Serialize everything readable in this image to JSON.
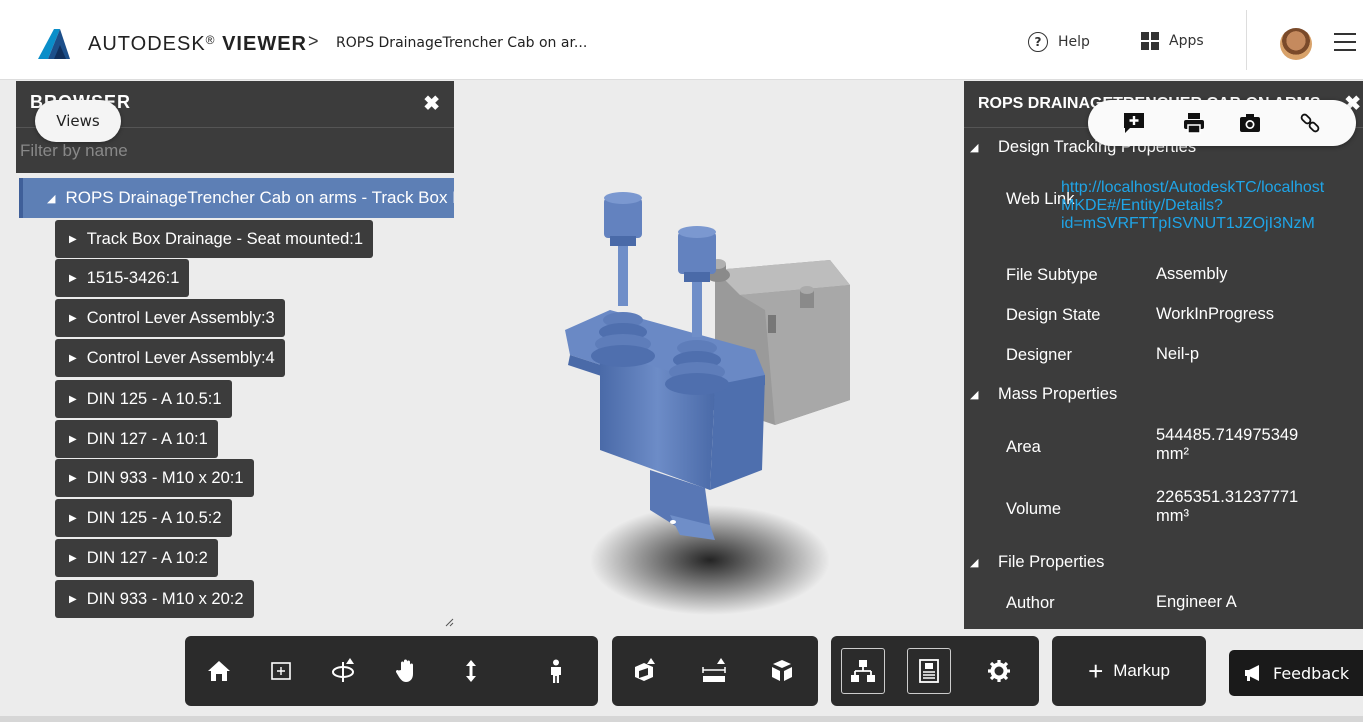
{
  "header": {
    "brand_light": "AUTODESK",
    "brand_reg": "®",
    "brand_bold": "VIEWER",
    "breadcrumb_sep": ">",
    "breadcrumb": "ROPS DrainageTrencher Cab on ar...",
    "help_icon": "?",
    "help_label": "Help",
    "apps_label": "Apps"
  },
  "browser": {
    "title": "BROWSER",
    "close": "✖",
    "views_label": "Views",
    "filter_placeholder": "Filter by name",
    "root": "ROPS DrainageTrencher Cab on arms - Track Box Drainage",
    "items": [
      {
        "label": "Track Box Drainage - Seat mounted:1"
      },
      {
        "label": "1515-3426:1"
      },
      {
        "label": "Control Lever Assembly:3"
      },
      {
        "label": "Control Lever Assembly:4"
      },
      {
        "label": "DIN 125 - A 10.5:1"
      },
      {
        "label": "DIN 127 - A 10:1"
      },
      {
        "label": "DIN 933 - M10 x 20:1"
      },
      {
        "label": "DIN 125 - A 10.5:2"
      },
      {
        "label": "DIN 127 - A 10:2"
      },
      {
        "label": "DIN 933 - M10 x 20:2"
      }
    ]
  },
  "properties": {
    "title": "ROPS DRAINAGETRENCHER CAB ON ARMS",
    "close": "✖",
    "sections": {
      "design_tracking": "Design Tracking Properties",
      "mass": "Mass Properties",
      "file": "File Properties"
    },
    "web_link_key": "Web Link",
    "web_link_line1": "http://localhost/AutodeskTC/localhost",
    "web_link_line2": "MKDE#/Entity/Details?",
    "web_link_line3": "id=mSVRFTTpISVNUT1JZOjI3NzM",
    "file_subtype_key": "File Subtype",
    "file_subtype_val": "Assembly",
    "design_state_key": "Design State",
    "design_state_val": "WorkInProgress",
    "designer_key": "Designer",
    "designer_val": "Neil-p",
    "area_key": "Area",
    "area_val_line1": "544485.714975349",
    "area_val_line2": "mm²",
    "volume_key": "Volume",
    "volume_val_line1": "2265351.31237771",
    "volume_val_line2": "mm³",
    "author_key": "Author",
    "author_val": "Engineer A"
  },
  "toolbar": {
    "markup_plus": "+",
    "markup_label": "Markup",
    "feedback_label": "Feedback"
  },
  "colors": {
    "accent_blue": "#5d7fb5",
    "panel_dark": "#3c3c3c",
    "link_blue": "#1fa5e8",
    "model_blue": "#5877b5"
  }
}
